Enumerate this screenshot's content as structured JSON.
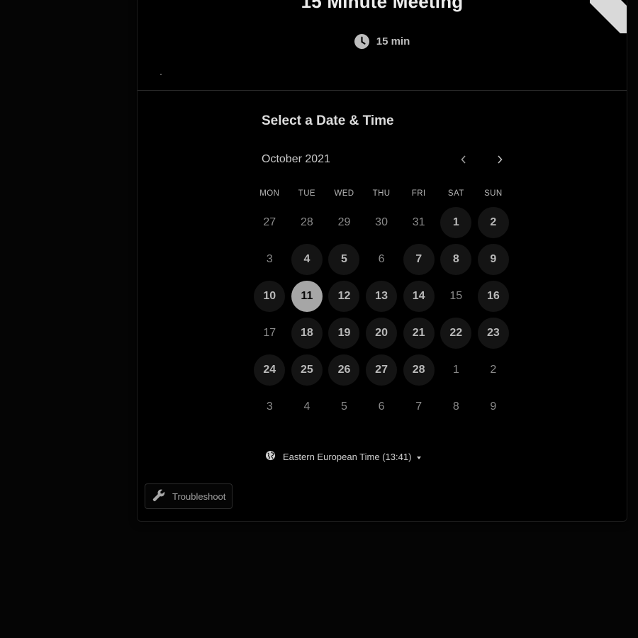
{
  "event": {
    "title": "15 Minute Meeting",
    "duration": "15 min",
    "icons": {
      "duration": "clock-icon"
    }
  },
  "booking": {
    "heading": "Select a Date & Time",
    "month_label": "October 2021",
    "nav": {
      "prev_icon": "chevron-left-icon",
      "next_icon": "chevron-right-icon"
    },
    "weekdays": [
      "MON",
      "TUE",
      "WED",
      "THU",
      "FRI",
      "SAT",
      "SUN"
    ],
    "days": [
      {
        "label": "27",
        "state": "muted"
      },
      {
        "label": "28",
        "state": "muted"
      },
      {
        "label": "29",
        "state": "muted"
      },
      {
        "label": "30",
        "state": "muted"
      },
      {
        "label": "31",
        "state": "muted"
      },
      {
        "label": "1",
        "state": "available"
      },
      {
        "label": "2",
        "state": "available"
      },
      {
        "label": "3",
        "state": "muted"
      },
      {
        "label": "4",
        "state": "available"
      },
      {
        "label": "5",
        "state": "available"
      },
      {
        "label": "6",
        "state": "muted"
      },
      {
        "label": "7",
        "state": "available"
      },
      {
        "label": "8",
        "state": "available"
      },
      {
        "label": "9",
        "state": "available"
      },
      {
        "label": "10",
        "state": "available"
      },
      {
        "label": "11",
        "state": "selected"
      },
      {
        "label": "12",
        "state": "available"
      },
      {
        "label": "13",
        "state": "available"
      },
      {
        "label": "14",
        "state": "available"
      },
      {
        "label": "15",
        "state": "muted"
      },
      {
        "label": "16",
        "state": "available"
      },
      {
        "label": "17",
        "state": "muted"
      },
      {
        "label": "18",
        "state": "available"
      },
      {
        "label": "19",
        "state": "available"
      },
      {
        "label": "20",
        "state": "available"
      },
      {
        "label": "21",
        "state": "available"
      },
      {
        "label": "22",
        "state": "available"
      },
      {
        "label": "23",
        "state": "available"
      },
      {
        "label": "24",
        "state": "available"
      },
      {
        "label": "25",
        "state": "available"
      },
      {
        "label": "26",
        "state": "available"
      },
      {
        "label": "27",
        "state": "available"
      },
      {
        "label": "28",
        "state": "available"
      },
      {
        "label": "1",
        "state": "muted"
      },
      {
        "label": "2",
        "state": "muted"
      },
      {
        "label": "3",
        "state": "muted"
      },
      {
        "label": "4",
        "state": "muted"
      },
      {
        "label": "5",
        "state": "muted"
      },
      {
        "label": "6",
        "state": "muted"
      },
      {
        "label": "7",
        "state": "muted"
      },
      {
        "label": "8",
        "state": "muted"
      },
      {
        "label": "9",
        "state": "muted"
      }
    ],
    "timezone": {
      "name": "Eastern European Time",
      "time": "(13:41)",
      "icon": "globe-icon"
    }
  },
  "footer": {
    "troubleshoot_label": "Troubleshoot",
    "troubleshoot_icon": "wrench-icon"
  },
  "colors": {
    "background": "#050505",
    "card": "#000000",
    "selected_day": "#a6a6a6",
    "available_day": "#141414"
  }
}
